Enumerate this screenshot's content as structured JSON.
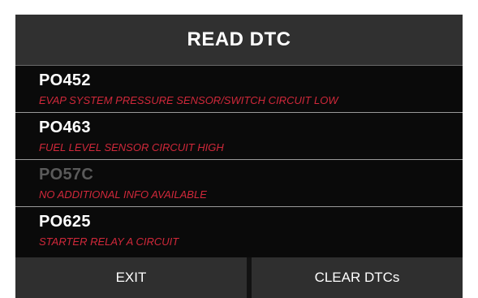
{
  "header": {
    "title": "READ DTC"
  },
  "dtcs": [
    {
      "code": "PO452",
      "description": "EVAP SYSTEM PRESSURE SENSOR/SWITCH CIRCUIT LOW"
    },
    {
      "code": "PO463",
      "description": "FUEL LEVEL SENSOR CIRCUIT HIGH"
    },
    {
      "code": "PO57C",
      "description": "NO ADDITIONAL INFO AVAILABLE"
    },
    {
      "code": "PO625",
      "description": "STARTER RELAY A CIRCUIT"
    }
  ],
  "footer": {
    "exit_label": "EXIT",
    "clear_label": "CLEAR DTCs"
  },
  "colors": {
    "background": "#121212",
    "header": "#303030",
    "code_text": "#ffffff",
    "dim_code_text": "#5a5a5a",
    "description_text": "#d0283a",
    "button": "#2f2f2f"
  }
}
